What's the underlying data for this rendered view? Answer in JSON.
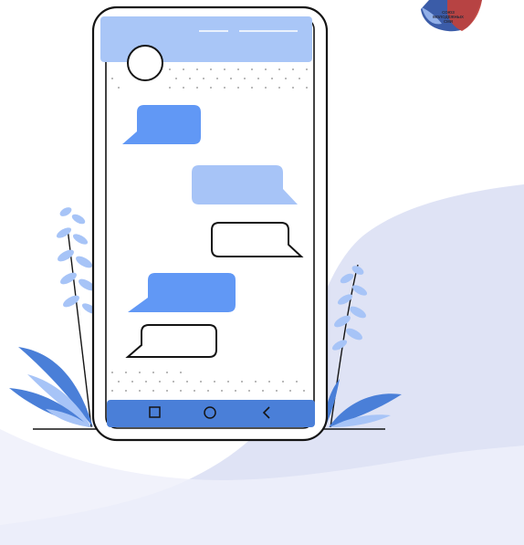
{
  "colors": {
    "background": "#ffffff",
    "backdrop_blob": "#dfe3f5",
    "outline": "#141414",
    "phone_screen": "#ffffff",
    "header_bar": "#a9c6f7",
    "nav_bar": "#4a7fd8",
    "bubble_dark": "#6198f5",
    "bubble_light": "#a7c4f7",
    "bubble_outline_fill": "#ffffff",
    "leaf_dark": "#4a7fd8",
    "leaf_light": "#a7c4f7",
    "dots": "#8a8a8a",
    "logo_red": "#c2413b",
    "logo_blue": "#3b5ca8"
  },
  "logo": {
    "lines": [
      "СОЮЗ",
      "МОЛОДЁЖНЫХ",
      "СМИ"
    ]
  },
  "icons": {
    "nav_square": "square-icon",
    "nav_home": "circle-home-icon",
    "nav_back": "back-chevron-icon",
    "avatar": "avatar-circle-icon"
  },
  "chat": {
    "messages": [
      {
        "side": "left",
        "style": "dark"
      },
      {
        "side": "right",
        "style": "light"
      },
      {
        "side": "right",
        "style": "outline"
      },
      {
        "side": "left",
        "style": "dark"
      },
      {
        "side": "left",
        "style": "outline"
      }
    ]
  }
}
